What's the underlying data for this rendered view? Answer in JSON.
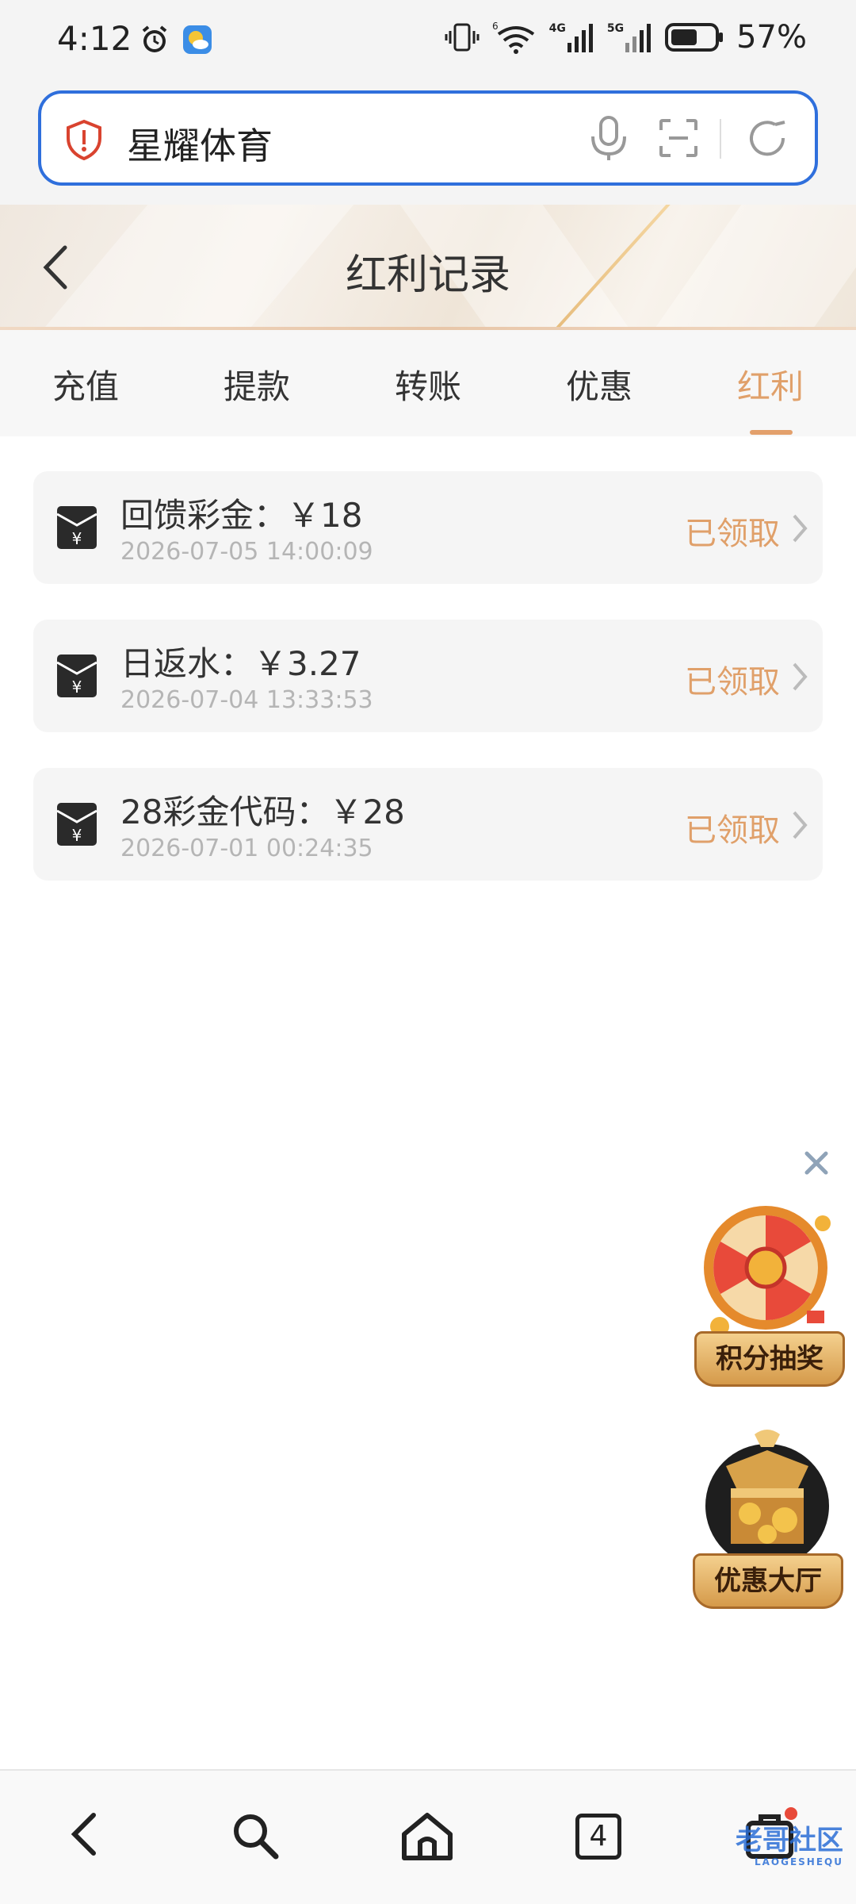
{
  "status_bar": {
    "time": "4:12",
    "battery_percent": "57%",
    "network_labels": [
      "4G",
      "5G"
    ]
  },
  "browser": {
    "search_text": "星耀体育",
    "tab_count": "4"
  },
  "header": {
    "title": "红利记录"
  },
  "tabs": [
    {
      "label": "充值",
      "active": false
    },
    {
      "label": "提款",
      "active": false
    },
    {
      "label": "转账",
      "active": false
    },
    {
      "label": "优惠",
      "active": false
    },
    {
      "label": "红利",
      "active": true
    }
  ],
  "records": [
    {
      "title": "回馈彩金：￥18",
      "date": "2026-07-05 14:00:09",
      "status": "已领取"
    },
    {
      "title": "日返水：￥3.27",
      "date": "2026-07-04 13:33:53",
      "status": "已领取"
    },
    {
      "title": "28彩金代码：￥28",
      "date": "2026-07-01 00:24:35",
      "status": "已领取"
    }
  ],
  "floating": {
    "lottery_label": "积分抽奖",
    "promo_label": "优惠大厅"
  },
  "watermark": {
    "text": "老哥社区",
    "subtext": "LAOGESHEQU"
  },
  "colors": {
    "accent": "#e0a06a",
    "url_border": "#2f6fdc",
    "date_text": "#b5b5b5"
  }
}
